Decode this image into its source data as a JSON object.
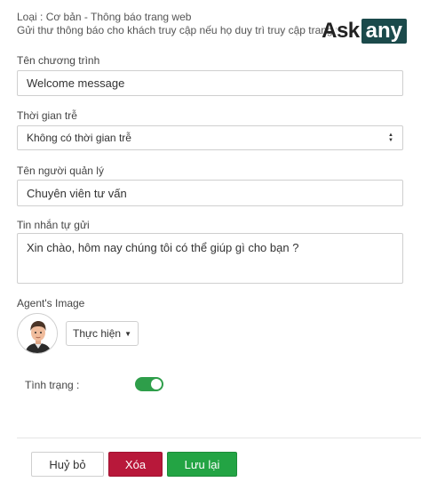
{
  "header": {
    "type_line": "Loại : Cơ bản - Thông báo trang web",
    "description": "Gửi thư thông báo cho khách truy cập nếu họ duy trì truy cập trang từ "
  },
  "logo": {
    "ask": "Ask",
    "any": "any"
  },
  "form": {
    "program_name": {
      "label": "Tên chương trình",
      "value": "Welcome message"
    },
    "delay": {
      "label": "Thời gian trễ",
      "value": "Không có thời gian trễ"
    },
    "manager": {
      "label": "Tên người quản lý",
      "value": "Chuyên viên tư vấn"
    },
    "auto_message": {
      "label": "Tin nhắn tự gửi",
      "value": "Xin chào, hôm nay chúng tôi có thể giúp gì cho bạn ?"
    },
    "agent_image": {
      "label": "Agent's Image",
      "action_label": "Thực hiện"
    },
    "status": {
      "label": "Tình trạng :",
      "enabled": true
    }
  },
  "footer": {
    "cancel_label": "Huỷ bỏ",
    "delete_label": "Xóa",
    "save_label": "Lưu lại"
  },
  "colors": {
    "toggle_on": "#2e9e4a",
    "delete": "#b8183a",
    "save": "#23a444",
    "logo_dark": "#1b4a4b"
  }
}
